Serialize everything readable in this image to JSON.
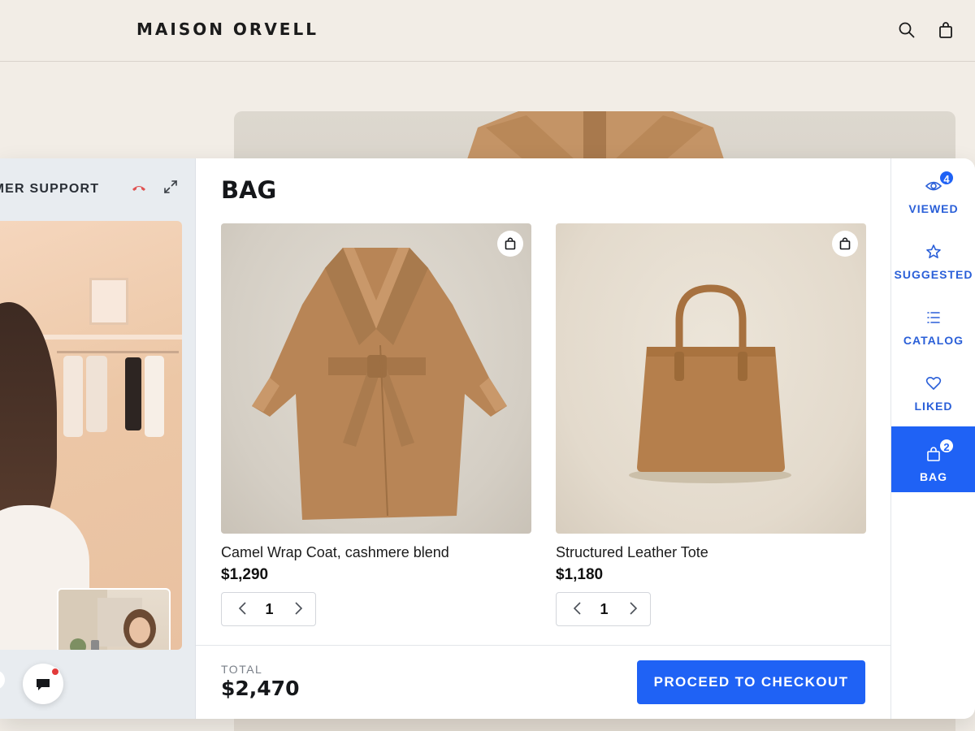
{
  "header": {
    "logo": "MAISON ORVELL",
    "icons": [
      "search-icon",
      "shopping-bag-icon"
    ]
  },
  "support": {
    "title": "OMER SUPPORT",
    "icons": [
      "hang-up-icon",
      "expand-icon",
      "chat-icon"
    ]
  },
  "bag": {
    "title": "BAG",
    "items": [
      {
        "name": "Camel Wrap Coat, cashmere blend",
        "price": "$1,290",
        "quantity": "1"
      },
      {
        "name": "Structured Leather Tote",
        "price": "$1,180",
        "quantity": "1"
      }
    ],
    "total_label": "TOTAL",
    "total_value": "$2,470",
    "checkout_label": "PROCEED TO CHECKOUT"
  },
  "rail": {
    "items": [
      {
        "label": "VIEWED",
        "badge": "4",
        "icon": "eye-icon"
      },
      {
        "label": "SUGGESTED",
        "icon": "star-icon"
      },
      {
        "label": "CATALOG",
        "icon": "list-icon"
      },
      {
        "label": "LIKED",
        "icon": "heart-icon"
      },
      {
        "label": "BAG",
        "badge": "2",
        "icon": "shopping-bag-icon",
        "active": true
      }
    ]
  },
  "colors": {
    "accent": "#1f62f5",
    "page_background": "#f2ede6",
    "notification": "#e23b3b"
  }
}
